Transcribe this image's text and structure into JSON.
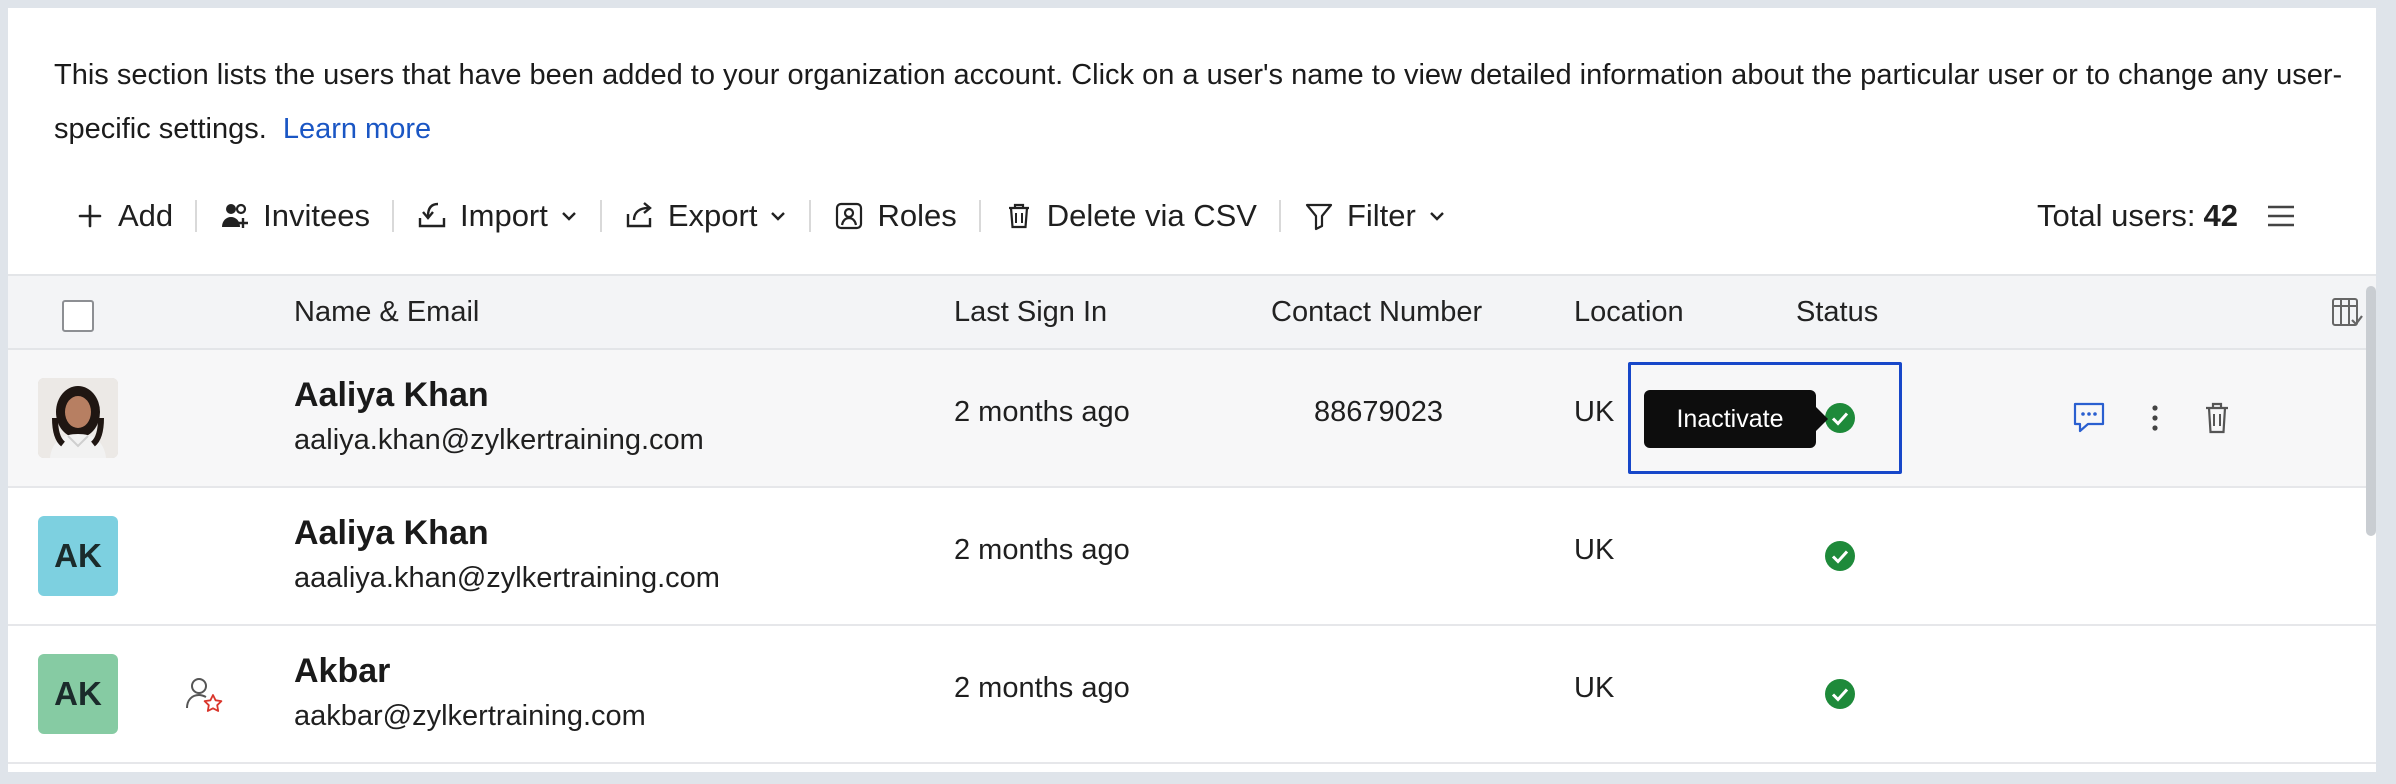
{
  "intro": {
    "text": "This section lists the users that have been added to your organization account. Click on a user's name to view detailed information about the particular user or to change any user-specific settings.",
    "link": "Learn more"
  },
  "toolbar": {
    "add": "Add",
    "invitees": "Invitees",
    "import": "Import",
    "export": "Export",
    "roles": "Roles",
    "delete_csv": "Delete via CSV",
    "filter": "Filter",
    "total_label": "Total users:",
    "total_count": "42"
  },
  "table": {
    "headers": {
      "name_email": "Name & Email",
      "last_sign_in": "Last Sign In",
      "contact": "Contact Number",
      "location": "Location",
      "status": "Status"
    },
    "rows": [
      {
        "initials": "",
        "name": "Aaliya Khan",
        "email": "aaliya.khan@zylkertraining.com",
        "last_sign_in": "2 months ago",
        "contact": "88679023",
        "location": "UK"
      },
      {
        "initials": "AK",
        "name": "Aaliya Khan",
        "email": "aaaliya.khan@zylkertraining.com",
        "last_sign_in": "2 months ago",
        "contact": "",
        "location": "UK"
      },
      {
        "initials": "AK",
        "name": "Akbar",
        "email": "aakbar@zylkertraining.com",
        "last_sign_in": "2 months ago",
        "contact": "",
        "location": "UK"
      }
    ]
  },
  "tooltip": "Inactivate",
  "colors": {
    "link": "#1a56c4",
    "status_active": "#1e8a3a",
    "highlight": "#1747c9",
    "avatar_blue": "#7dd0e0",
    "avatar_green": "#86cba3"
  }
}
